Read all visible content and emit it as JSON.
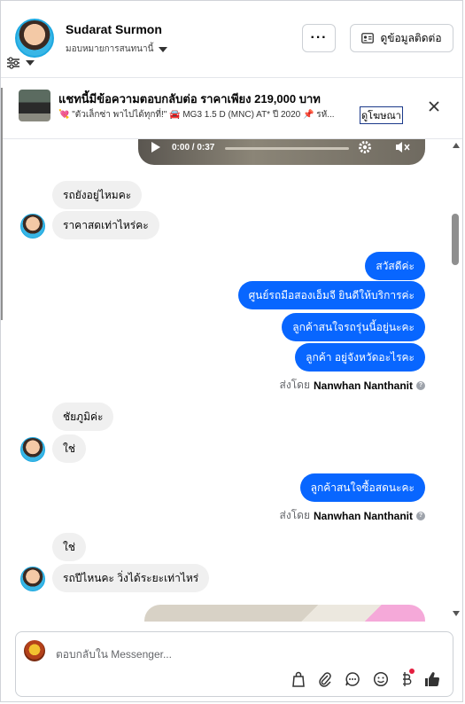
{
  "header": {
    "name": "Sudarat Surmon",
    "assign_label": "มอบหมายการสนทนานี้",
    "more_label": "···",
    "contact_label": "ดูข้อมูลติดต่อ"
  },
  "banner": {
    "title": "แชทนี้มีข้อความตอบกลับต่อ ราคาเพียง 219,000 บาท",
    "subtitle": "💘 \"ตัวเล็กซ่า พาไปได้ทุกที่!\" 🚘 MG3 1.5 D (MNC) AT* ปี 2020 📌 รหั...",
    "link_label": "ดูโฆษณา"
  },
  "video": {
    "time": "0:00 / 0:37"
  },
  "messages": {
    "in1": "รถยังอยู่ไหมคะ",
    "in2": "ราคาสดเท่าไหร่คะ",
    "out1": "สวัสดีค่ะ",
    "out2": "ศูนย์รถมือสองเอ็มจี ยินดีให้บริการค่ะ",
    "out3": "ลูกค้าสนใจรถรุ่นนี้อยู่นะคะ",
    "out4": "ลูกค้า อยู่จังหวัดอะไรคะ",
    "sent_by_prefix": "ส่งโดย",
    "sent_by_name": "Nanwhan Nanthanit",
    "in3": "ชัยภูมิค่ะ",
    "in4": "ใช่",
    "out5": "ลูกค้าสนใจซื้อสดนะคะ",
    "in5": "ใช่",
    "in6": "รถปีไหนคะ วิ่งได้ระยะเท่าไหร่"
  },
  "composer": {
    "placeholder": "ตอบกลับใน Messenger..."
  },
  "colors": {
    "accent": "#0866ff",
    "incoming_bubble": "#f0f0f0",
    "badge": "#e41e3f"
  }
}
